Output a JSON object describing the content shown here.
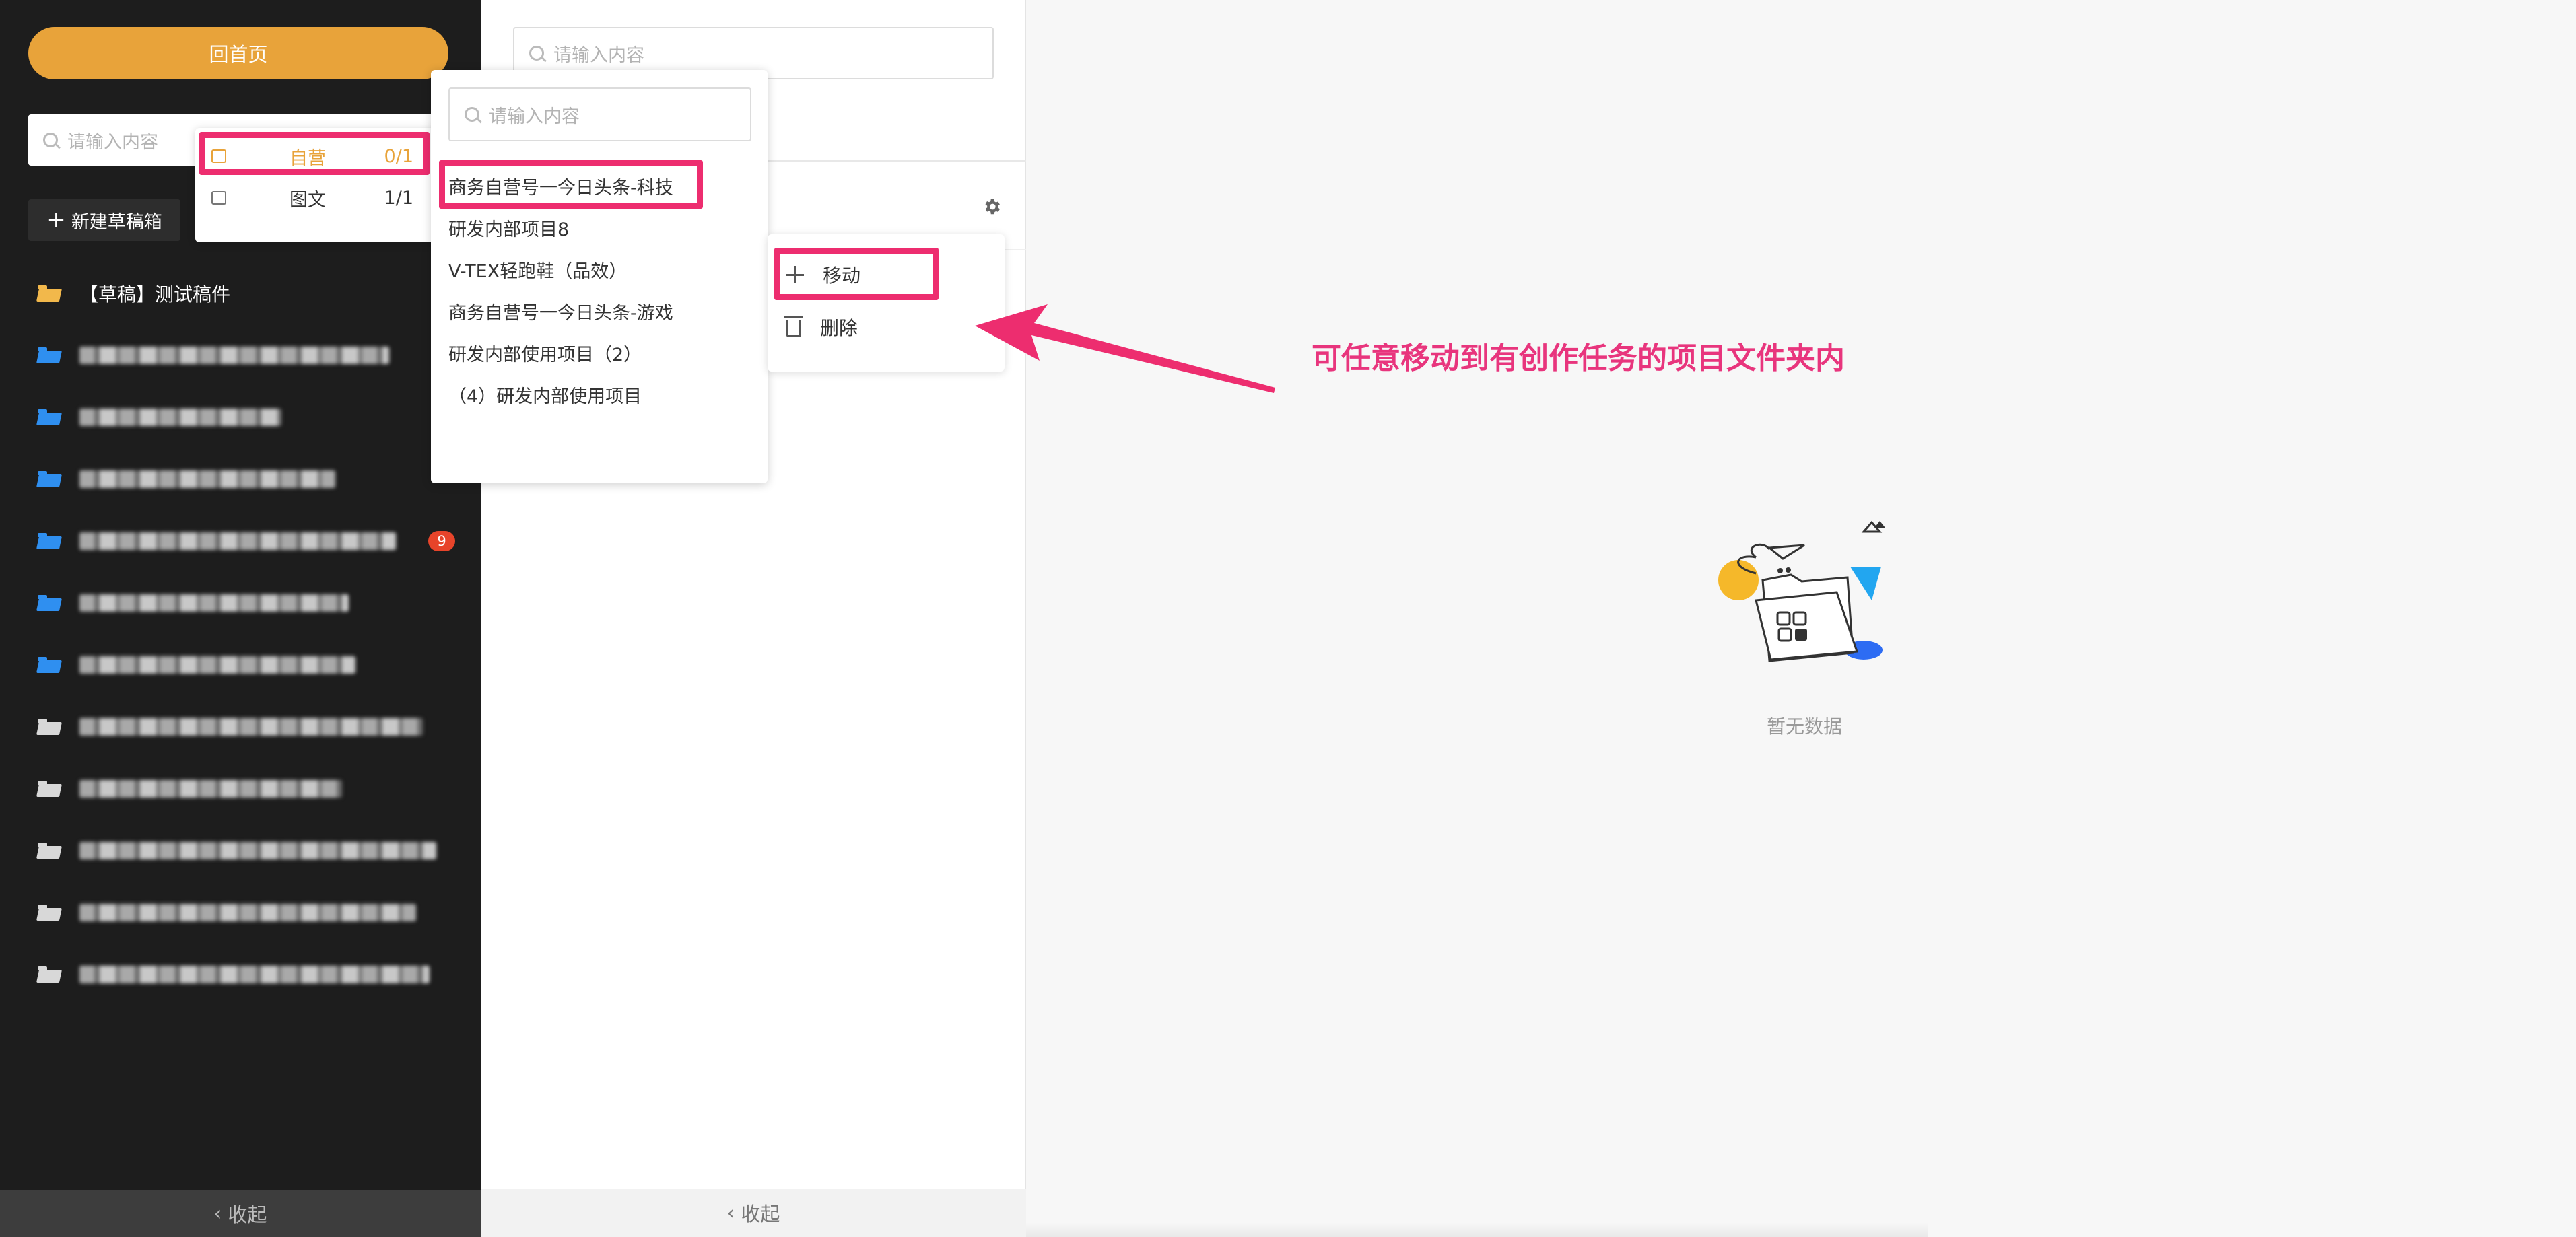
{
  "sidebar": {
    "home_button": "回首页",
    "search_placeholder": "请输入内容",
    "new_draft_button": "新建草稿箱",
    "draft_folder": "【草稿】测试稿件",
    "badge_count": "9",
    "collapse": "收起"
  },
  "middle": {
    "search_placeholder": "请输入内容",
    "collapse": "收起"
  },
  "category_popup": {
    "items": [
      {
        "label": "自营",
        "count": "0/1"
      },
      {
        "label": "图文",
        "count": "1/1"
      }
    ]
  },
  "project_popup": {
    "search_placeholder": "请输入内容",
    "items": [
      "商务自营号一今日头条-科技",
      "研发内部项目8",
      "V-TEX轻跑鞋（品效）",
      "商务自营号一今日头条-游戏",
      "研发内部使用项目（2）",
      "（4）研发内部使用项目"
    ]
  },
  "action_menu": {
    "move": "移动",
    "delete": "删除"
  },
  "annotation": "可任意移动到有创作任务的项目文件夹内",
  "empty_state": "暂无数据",
  "colors": {
    "accent": "#e8a33a",
    "highlight": "#ed2d6f",
    "folder_blue": "#2f8ff0",
    "badge": "#e7442a",
    "sidebar_bg": "#1d1d1d"
  }
}
